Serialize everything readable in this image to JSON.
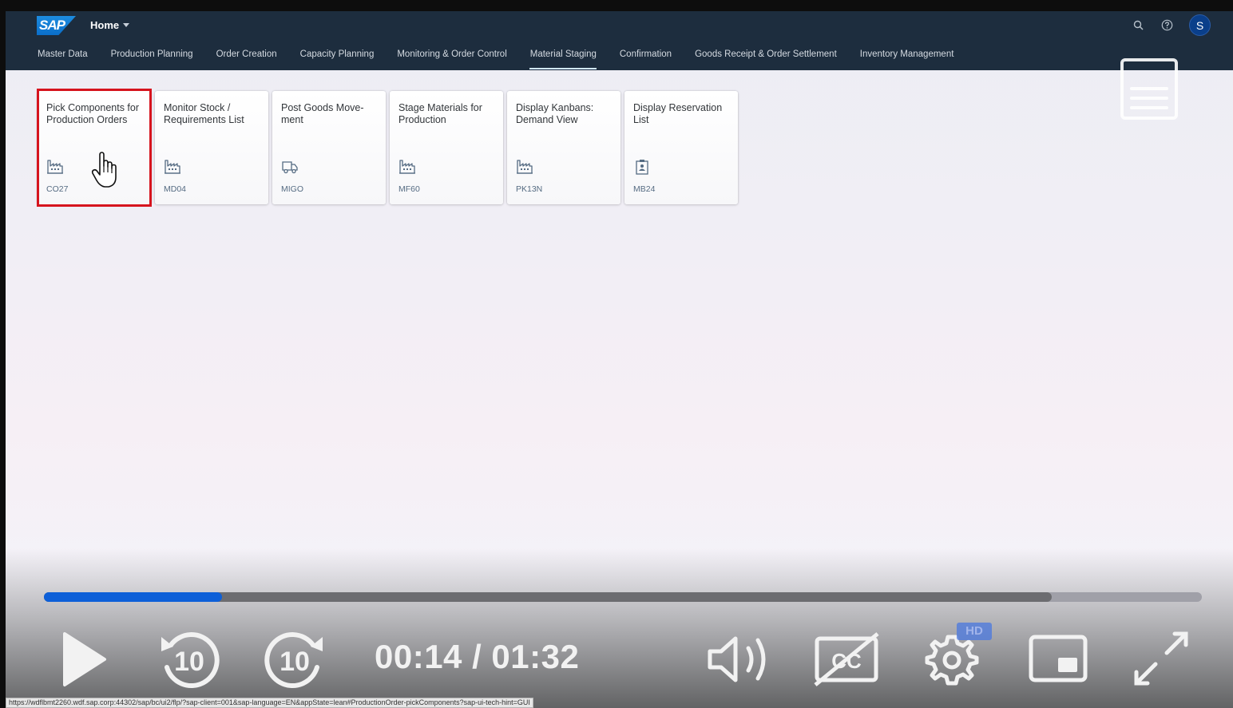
{
  "shell": {
    "logo": "SAP",
    "home_label": "Home",
    "avatar_initial": "S",
    "icons": [
      "search-icon",
      "help-icon"
    ]
  },
  "tabs": [
    {
      "label": "Master Data",
      "active": false
    },
    {
      "label": "Production Planning",
      "active": false
    },
    {
      "label": "Order Creation",
      "active": false
    },
    {
      "label": "Capacity Planning",
      "active": false
    },
    {
      "label": "Monitoring & Order Control",
      "active": false
    },
    {
      "label": "Material Staging",
      "active": true
    },
    {
      "label": "Confirmation",
      "active": false
    },
    {
      "label": "Goods Receipt & Order Settlement",
      "active": false
    },
    {
      "label": "Inventory Management",
      "active": false
    }
  ],
  "tiles": [
    {
      "title": "Pick Components for Production Orders",
      "code": "CO27",
      "icon": "factory-icon"
    },
    {
      "title": "Monitor Stock / Requirements List",
      "code": "MD04",
      "icon": "factory-icon"
    },
    {
      "title": "Post Goods Move-ment",
      "code": "MIGO",
      "icon": "truck-icon"
    },
    {
      "title": "Stage Materials for Production",
      "code": "MF60",
      "icon": "factory-icon"
    },
    {
      "title": "Display Kanbans: Demand View",
      "code": "PK13N",
      "icon": "factory-icon"
    },
    {
      "title": "Display Reservation List",
      "code": "MB24",
      "icon": "clipboard-icon"
    }
  ],
  "player": {
    "time": "00:14 / 01:32",
    "progress": 0.154,
    "buffered": 0.87,
    "hd_label": "HD",
    "rewind_label": "10",
    "forward_label": "10"
  },
  "status_url": "https://wdflbmt2260.wdf.sap.corp:44302/sap/bc/ui2/flp/?sap-client=001&sap-language=EN&appState=lean#ProductionOrder-pickComponents?sap-ui-tech-hint=GUI",
  "colors": {
    "shell": "#1d2d3e",
    "progress_fill": "#0d5fd8",
    "highlight": "#d6141e"
  }
}
